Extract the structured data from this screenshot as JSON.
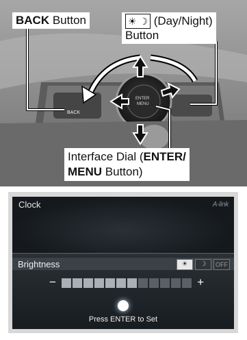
{
  "callouts": {
    "back_bold": "BACK",
    "back_rest": " Button",
    "daynight_rest": " (Day/Night)",
    "daynight_line2": "Button",
    "dial_line1": "Interface Dial (",
    "dial_bold1": "ENTER/",
    "dial_bold2": "MENU",
    "dial_rest2": " Button)"
  },
  "photo": {
    "back_btn_label": "BACK",
    "dial_label_1": "ENTER",
    "dial_label_2": "MENU"
  },
  "screen": {
    "title": "Clock",
    "brand": "A-link",
    "brightness_label": "Brightness",
    "mode_off": "OFF",
    "minus": "−",
    "plus": "+",
    "level": 0.6,
    "instruction": "Press ENTER to Set"
  }
}
